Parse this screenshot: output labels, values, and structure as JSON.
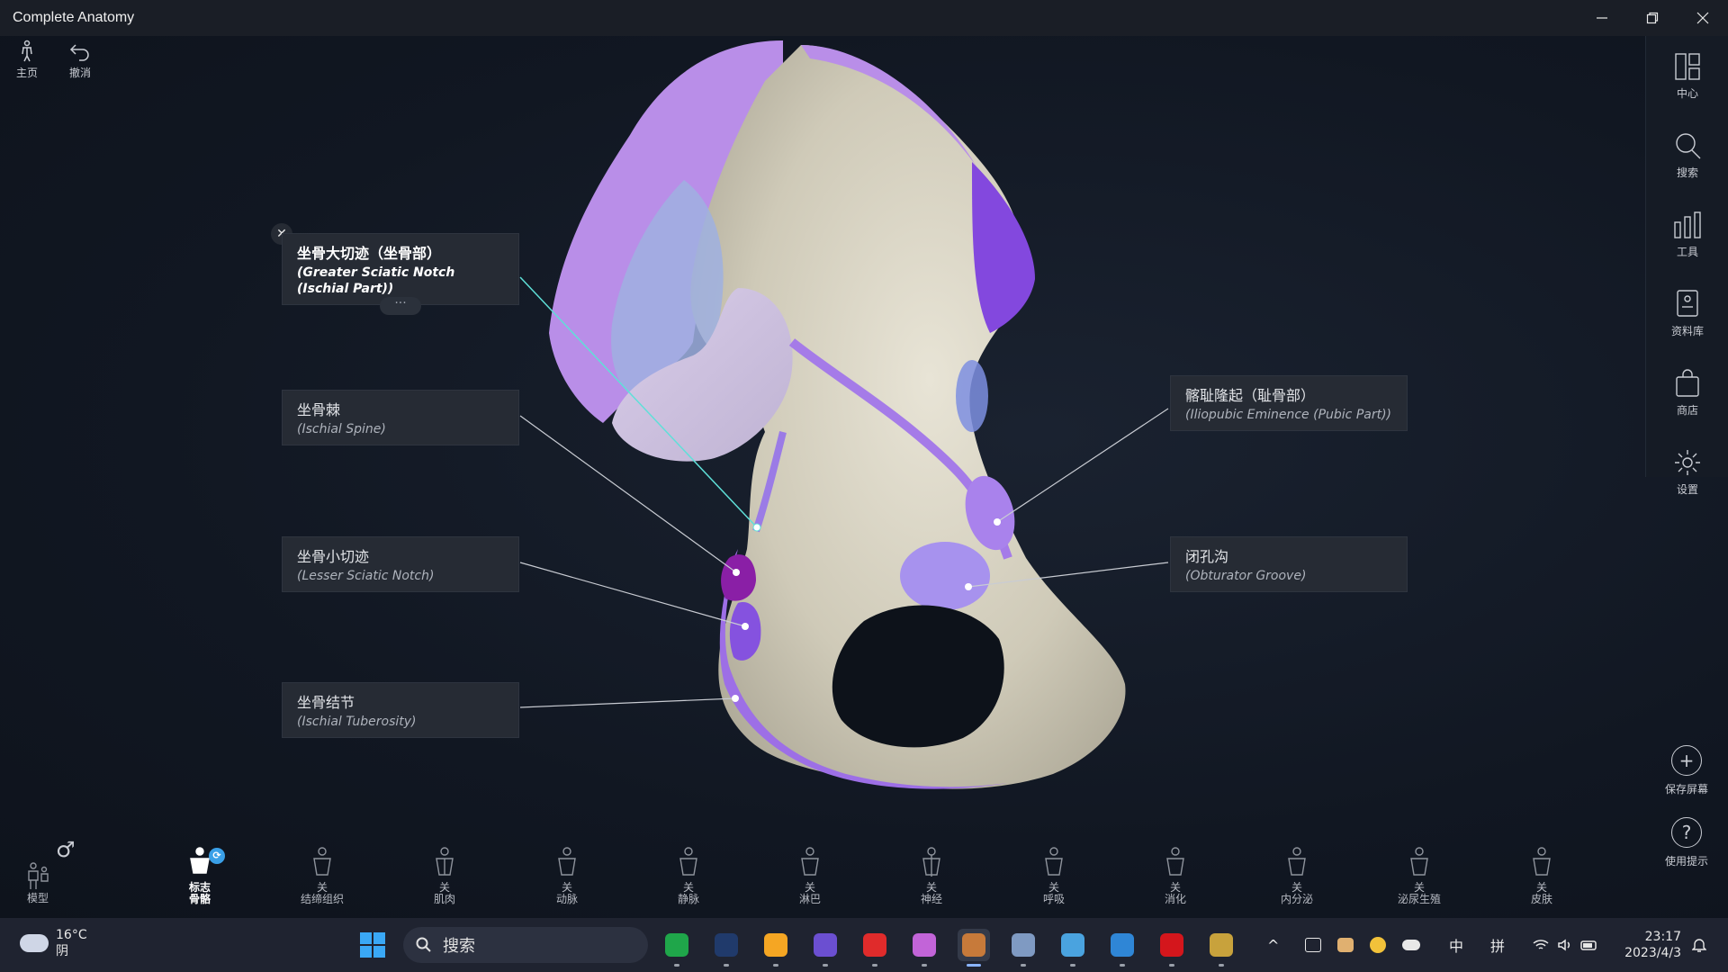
{
  "window": {
    "title": "Complete Anatomy",
    "minimize_glyph": "—",
    "maximize_glyph": "❐",
    "close_glyph": "✕"
  },
  "top_tools": [
    {
      "label": "主页",
      "icon": "home-figure-icon"
    },
    {
      "label": "撤消",
      "icon": "undo-icon"
    }
  ],
  "right_panel": {
    "items": [
      {
        "label": "中心",
        "icon": "layout-icon"
      },
      {
        "label": "搜索",
        "icon": "search-icon"
      },
      {
        "label": "工具",
        "icon": "tools-icon"
      },
      {
        "label": "资料库",
        "icon": "library-icon"
      },
      {
        "label": "商店",
        "icon": "store-icon"
      },
      {
        "label": "设置",
        "icon": "gear-icon"
      }
    ],
    "save_screen": {
      "label": "保存屏幕",
      "glyph": "+"
    },
    "usage_tips": {
      "label": "使用提示",
      "glyph": "?"
    }
  },
  "labels": {
    "greater_sciatic": {
      "zh": "坐骨大切迹（坐骨部）",
      "en": "(Greater Sciatic Notch (Ischial Part))",
      "selected": true,
      "close": "✕",
      "more": "···"
    },
    "ischial_spine": {
      "zh": "坐骨棘",
      "en": "(Ischial Spine)"
    },
    "lesser_sciatic": {
      "zh": "坐骨小切迹",
      "en": "(Lesser Sciatic Notch)"
    },
    "ischial_tuberosity": {
      "zh": "坐骨结节",
      "en": "(Ischial Tuberosity)"
    },
    "iliopubic": {
      "zh": "髂耻隆起（耻骨部）",
      "en": "(Iliopubic Eminence (Pubic Part))"
    },
    "obturator": {
      "zh": "闭孔沟",
      "en": "(Obturator Groove)"
    }
  },
  "bottom_bar": {
    "model": {
      "label": "模型",
      "gender_glyph": "♂"
    },
    "systems": [
      {
        "line1": "标志",
        "line2": "骨骼",
        "active": true,
        "badge": "⟳"
      },
      {
        "line1": "关",
        "line2": "结缔组织"
      },
      {
        "line1": "关",
        "line2": "肌肉"
      },
      {
        "line1": "关",
        "line2": "动脉"
      },
      {
        "line1": "关",
        "line2": "静脉"
      },
      {
        "line1": "关",
        "line2": "淋巴"
      },
      {
        "line1": "关",
        "line2": "神经"
      },
      {
        "line1": "关",
        "line2": "呼吸"
      },
      {
        "line1": "关",
        "line2": "消化"
      },
      {
        "line1": "关",
        "line2": "内分泌"
      },
      {
        "line1": "关",
        "line2": "泌尿生殖"
      },
      {
        "line1": "关",
        "line2": "皮肤"
      }
    ]
  },
  "taskbar": {
    "weather": {
      "temp": "16°C",
      "condition": "阴"
    },
    "search_placeholder": "搜索",
    "apps": [
      {
        "name": "green-app-icon",
        "color": "#1fa64a"
      },
      {
        "name": "cat-app-icon",
        "color": "#203a6b"
      },
      {
        "name": "g-app-icon",
        "color": "#f5a623"
      },
      {
        "name": "crystal-app-icon",
        "color": "#6b4fd1"
      },
      {
        "name": "netease-music-icon",
        "color": "#e02b2b"
      },
      {
        "name": "purple-ball-icon",
        "color": "#c264d8"
      },
      {
        "name": "complete-anatomy-icon",
        "color": "#c77a3a"
      },
      {
        "name": "gear-app-icon",
        "color": "#7f9ac2"
      },
      {
        "name": "monitor-app-icon",
        "color": "#4aa3df"
      },
      {
        "name": "blue-app-icon",
        "color": "#2f86d6"
      },
      {
        "name": "acrobat-icon",
        "color": "#d4161c"
      },
      {
        "name": "league-icon",
        "color": "#c8a23c"
      }
    ],
    "tray": {
      "chevron": "^",
      "ime1": "中",
      "ime2": "拼"
    },
    "clock": {
      "time": "23:17",
      "date": "2023/4/3"
    }
  }
}
